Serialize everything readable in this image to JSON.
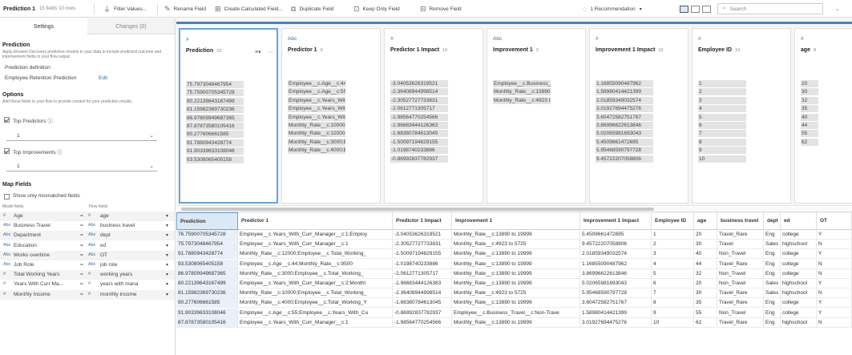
{
  "toolbar": {
    "title": "Prediction 1",
    "meta": "15 fields  10 rows",
    "filter": "Filter Values...",
    "rename": "Rename Field",
    "calc": "Create Calculated Field...",
    "duplicate": "Duplicate Field",
    "keep": "Keep Only Field",
    "remove": "Remove Field",
    "recommend": "1 Recommendation",
    "search_placeholder": "Search"
  },
  "left": {
    "tabs": [
      "Settings",
      "Changes (0)"
    ],
    "prediction_title": "Prediction",
    "prediction_desc": "Apply Einstein Discovery predictive models to your data to include predicted outcome and improvement fields in your flow output.",
    "definition_label": "Prediction definition",
    "definition_value": "Employee Retention Prediction",
    "edit": "Edit",
    "options_title": "Options",
    "options_desc": "Add these fields to your flow to provide context for your prediction results.",
    "top_predictors": "Top Predictors ⓘ",
    "top_predictors_value": "1",
    "top_improvements": "Top Improvements ⓘ",
    "top_improvements_value": "1",
    "map_title": "Map Fields",
    "mismatch": "Show only mismatched fields",
    "model_hdr": "Model fields",
    "flow_hdr": "Flow fields",
    "rows": [
      {
        "mt": "#",
        "model": "Age",
        "ft": "#",
        "flow": "age"
      },
      {
        "mt": "Abc",
        "model": "Business Travel",
        "ft": "Abc",
        "flow": "business travel"
      },
      {
        "mt": "Abc",
        "model": "Department",
        "ft": "Abc",
        "flow": "dept"
      },
      {
        "mt": "Abc",
        "model": "Education",
        "ft": "Abc",
        "flow": "ed"
      },
      {
        "mt": "Abc",
        "model": "Works overtime",
        "ft": "Abc",
        "flow": "OT"
      },
      {
        "mt": "Abc",
        "model": "Job Role",
        "ft": "Abc",
        "flow": "job role"
      },
      {
        "mt": "#",
        "model": "Total Working Years",
        "ft": "#",
        "flow": "working years"
      },
      {
        "mt": "#",
        "model": "Years With Curr Ma...",
        "ft": "#",
        "flow": "years with mana"
      },
      {
        "mt": "#",
        "model": "Monthly Income",
        "ft": "#",
        "flow": "monthly income"
      }
    ]
  },
  "cards": [
    {
      "type": "#",
      "name": "Prediction",
      "count": "10",
      "values": [
        "75.7973048467954",
        "75.7590070534572​8",
        "80.22139643167499",
        "81.15982369730236",
        "86.97809949687365",
        "87.87873580105416",
        "90.277606661585",
        "91.7880943428774",
        "91.90339633108046",
        "93.5308065405158"
      ]
    },
    {
      "type": "Abc",
      "name": "Predictor 1",
      "count": "9",
      "values": [
        "Employee__c.Age__c:44;Mo...",
        "Employee__c.Age__c:55;Em...",
        "Employee__c.Years_With_C...",
        "Employee__c.Years_With_C...",
        "Employee__c.Years_With_C...",
        "Monthly_Rate__c:10000;E...",
        "Monthly_Rate__c:12000;E...",
        "Monthly_Rate__c:3000;Em...",
        "Monthly_Rate__c:4000;Em..."
      ]
    },
    {
      "type": "#",
      "name": "Predictor 1 Impact",
      "count": "10",
      "values": [
        "-3.04053626319521",
        "-2.36408944998514",
        "-2.30527727733831",
        "-2.0612771305717",
        "-1.98564770254566",
        "-1.96683444126363",
        "-1.68380784613045",
        "-1.50097194829155",
        "-1.0198740233886",
        "-0.86992837782937"
      ]
    },
    {
      "type": "Abc",
      "name": "Improvement 1",
      "count": "3",
      "values": [
        "Employee__c.Business_Tra...",
        "Monthly_Rate__c:13890 to ...",
        "Monthly_Rate__c:4923 to 5..."
      ]
    },
    {
      "type": "#",
      "name": "Improvement 1 Impact",
      "count": "10",
      "values": [
        "1.16855090487962",
        "1.58980414421399",
        "2.01859349032574",
        "3.01927694475276",
        "3.60472582751767",
        "3.86996622613846",
        "5.02065981693043",
        "5.4509661472695",
        "5.95468590797728",
        "9.45722207058806"
      ]
    },
    {
      "type": "#",
      "name": "Employee ID",
      "count": "10",
      "values": [
        "1",
        "2",
        "3",
        "4",
        "5",
        "6",
        "7",
        "8",
        "9",
        "10"
      ]
    },
    {
      "type": "#",
      "name": "age",
      "count": "8",
      "values": [
        "20",
        "30",
        "32",
        "35",
        "40",
        "44",
        "55",
        "62"
      ]
    }
  ],
  "grid": {
    "headers": [
      "Prediction",
      "Predictor 1",
      "Predictor 1 Impact",
      "Improvement 1",
      "Improvement 1 Impact",
      "Employee ID",
      "age",
      "business travel",
      "dept",
      "ed",
      "OT"
    ],
    "rows": [
      [
        "76.75900705345728",
        "Employee__c.Years_With_Curr_Manager__c:1;Employ",
        "-3.04053626319521",
        "Monthly_Rate__c:13890 to 19999",
        "5.4509661472695",
        "1",
        "20",
        "Travel_Rare",
        "Eng",
        "college",
        "Y"
      ],
      [
        "75.7973048467954",
        "Employee__c.Years_With_Curr_Manager__c:1",
        "-2.30527727733831",
        "Monthly_Rate__c:4923 to 5725",
        "9.45722207058806",
        "2",
        "30",
        "Travel",
        "Sales",
        "highschool",
        "N"
      ],
      [
        "91.7880943428774",
        "Monthly_Rate__c:12000;Employee__c.Total_Working_",
        "-1.50097194829155",
        "Monthly_Rate__c:13890 to 19999",
        "2.01859349032574",
        "3",
        "40",
        "Non_Travel",
        "Eng",
        "college",
        "Y"
      ],
      [
        "93.5308065405158",
        "Employee__c.Age__c:44;Monthly_Rate__c:9500",
        "-1.0198740233886",
        "Monthly_Rate__c:13890 to 19999",
        "1.16855090487962",
        "4",
        "44",
        "Travel_Rare",
        "Eng",
        "college",
        "N"
      ],
      [
        "86.97809949687365",
        "Monthly_Rate__c:3000;Employee__c.Total_Working_",
        "-2.0612771305717",
        "Monthly_Rate__c:13890 to 19999",
        "3.86996622613846",
        "5",
        "32",
        "Non_Travel",
        "Eng",
        "college",
        "N"
      ],
      [
        "80.22139643167499",
        "Employee__c.Years_With_Curr_Manager__c:2;Monthl",
        "-1.96683444126363",
        "Monthly_Rate__c:13890 to 19999",
        "5.02065981693043",
        "6",
        "20",
        "Non_Travel",
        "Sales",
        "highschool",
        "Y"
      ],
      [
        "81.15982369730236",
        "Monthly_Rate__c:10000;Employee__c.Total_Working_",
        "-2.36408944998514",
        "Monthly_Rate__c:4923 to 5725",
        "5.95468590797728",
        "7",
        "30",
        "Travel_Rare",
        "Sales",
        "highschool",
        "N"
      ],
      [
        "90.277606661585",
        "Monthly_Rate__c:4000;Employee__c.Total_Working_Y",
        "-1.68380784613045",
        "Monthly_Rate__c:13890 to 19999",
        "3.60472582751767",
        "8",
        "35",
        "Travel_Rare",
        "Eng",
        "college",
        "Y"
      ],
      [
        "91.90339633108046",
        "Employee__c.Age__c:55;Employee__c.Years_With_Cu",
        "-0.86992837782937",
        "Employee__c.Business_Travel__c:Non-Trave",
        "1.58980414421399",
        "9",
        "55",
        "Non_Travel",
        "Eng",
        "college",
        "Y"
      ],
      [
        "87.87873580105416",
        "Employee__c.Years_With_Curr_Manager__c:1",
        "-1.98564770254566",
        "Monthly_Rate__c:13890 to 19999",
        "3.01927694475276",
        "10",
        "62",
        "Travel_Rare",
        "Eng",
        "highschool",
        "N"
      ]
    ]
  }
}
